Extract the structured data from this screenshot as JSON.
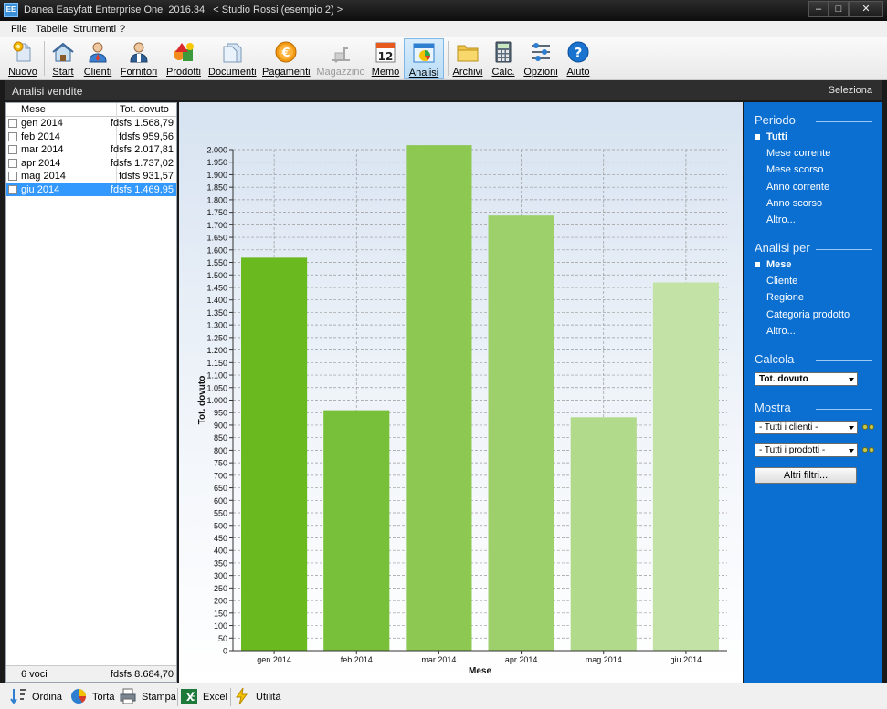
{
  "window": {
    "title": "Danea Easyfatt Enterprise One  2016.34   < Studio Rossi (esempio 2) >",
    "app_icon": "EE"
  },
  "menu": [
    "File",
    "Tabelle",
    "Strumenti",
    "?"
  ],
  "toolbar": {
    "items": [
      {
        "label": "Nuovo",
        "icon": "new-icon"
      },
      {
        "label": "Start",
        "icon": "home-icon"
      },
      {
        "label": "Clienti",
        "icon": "client-icon"
      },
      {
        "label": "Fornitori",
        "icon": "supplier-icon"
      },
      {
        "label": "Prodotti",
        "icon": "products-icon"
      },
      {
        "label": "Documenti",
        "icon": "documents-icon"
      },
      {
        "label": "Pagamenti",
        "icon": "payments-icon"
      },
      {
        "label": "Magazzino",
        "icon": "warehouse-icon",
        "disabled": true
      },
      {
        "label": "Memo",
        "icon": "calendar-icon",
        "day": "12"
      },
      {
        "label": "Analisi",
        "icon": "analysis-icon",
        "active": true
      },
      {
        "label": "Archivi",
        "icon": "archive-icon"
      },
      {
        "label": "Calc.",
        "icon": "calculator-icon"
      },
      {
        "label": "Opzioni",
        "icon": "options-icon"
      },
      {
        "label": "Aiuto",
        "icon": "help-icon"
      }
    ]
  },
  "section": {
    "title": "Analisi vendite",
    "select_link": "Seleziona"
  },
  "list": {
    "columns": [
      "Mese",
      "Tot. dovuto"
    ],
    "rows": [
      {
        "mese": "gen 2014",
        "valore": "fdsfs 1.568,79"
      },
      {
        "mese": "feb 2014",
        "valore": "fdsfs 959,56"
      },
      {
        "mese": "mar 2014",
        "valore": "fdsfs 2.017,81"
      },
      {
        "mese": "apr 2014",
        "valore": "fdsfs 1.737,02"
      },
      {
        "mese": "mag 2014",
        "valore": "fdsfs 931,57"
      },
      {
        "mese": "giu 2014",
        "valore": "fdsfs 1.469,95",
        "selected": true
      }
    ],
    "footer_count": "6 voci",
    "footer_total": "fdsfs 8.684,70"
  },
  "chart_data": {
    "type": "bar",
    "categories": [
      "gen 2014",
      "feb 2014",
      "mar 2014",
      "apr 2014",
      "mag 2014",
      "giu 2014"
    ],
    "values": [
      1568.79,
      959.56,
      2017.81,
      1737.02,
      931.57,
      1469.95
    ],
    "xlabel": "Mese",
    "ylabel": "Tot. dovuto",
    "ylim": [
      0,
      2000
    ],
    "ytick_step": 50,
    "yticks": [
      "0",
      "50",
      "100",
      "150",
      "200",
      "250",
      "300",
      "350",
      "400",
      "450",
      "500",
      "550",
      "600",
      "650",
      "700",
      "750",
      "800",
      "850",
      "900",
      "950",
      "1.000",
      "1.050",
      "1.100",
      "1.150",
      "1.200",
      "1.250",
      "1.300",
      "1.350",
      "1.400",
      "1.450",
      "1.500",
      "1.550",
      "1.600",
      "1.650",
      "1.700",
      "1.750",
      "1.800",
      "1.850",
      "1.900",
      "1.950",
      "2.000"
    ],
    "grid": true,
    "bar_colors": [
      "#69b91f",
      "#79c03a",
      "#8cc852",
      "#9dd06b",
      "#b1da8a",
      "#c3e3a6"
    ]
  },
  "right_panel": {
    "periodo": {
      "title": "Periodo",
      "items": [
        "Tutti",
        "Mese corrente",
        "Mese scorso",
        "Anno corrente",
        "Anno scorso",
        "Altro..."
      ],
      "selected": "Tutti"
    },
    "analisi": {
      "title": "Analisi per",
      "items": [
        "Mese",
        "Cliente",
        "Regione",
        "Categoria prodotto",
        "Altro..."
      ],
      "selected": "Mese"
    },
    "calcola": {
      "title": "Calcola",
      "value": "Tot. dovuto"
    },
    "mostra": {
      "title": "Mostra",
      "clienti": "- Tutti i clienti -",
      "prodotti": "- Tutti i prodotti -"
    },
    "filters_button": "Altri filtri..."
  },
  "bottom_bar": {
    "items": [
      {
        "label": "Ordina",
        "icon": "sort-icon"
      },
      {
        "label": "Torta",
        "icon": "pie-icon"
      },
      {
        "label": "Stampa",
        "icon": "printer-icon"
      },
      {
        "label": "Excel",
        "icon": "excel-icon"
      },
      {
        "label": "Utilità",
        "icon": "lightning-icon"
      }
    ]
  },
  "colors": {
    "accent_panel": "#0a6fd0",
    "header_dark": "#2e2e2e",
    "selection": "#3399ff"
  }
}
